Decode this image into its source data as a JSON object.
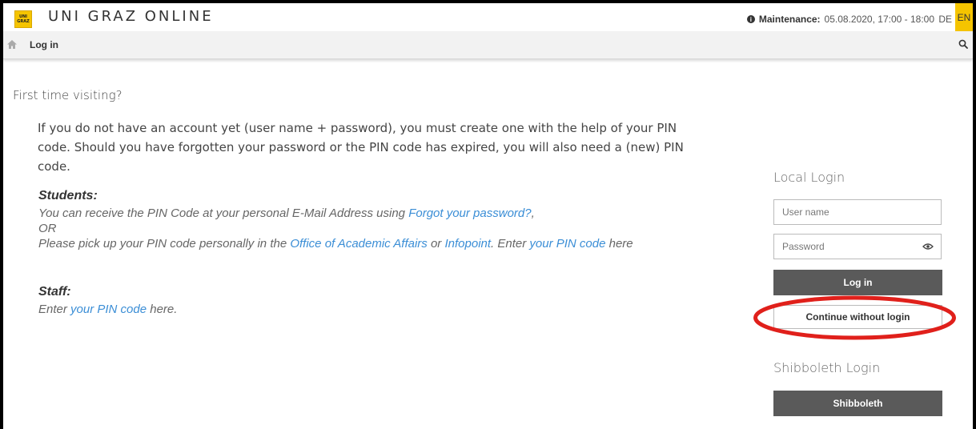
{
  "header": {
    "logo_text_top": "UNI",
    "logo_text_bottom": "GRAZ",
    "brand": "UNI GRAZ ONLINE",
    "maintenance_label": "Maintenance:",
    "maintenance_value": "05.08.2020, 17:00 - 18:00",
    "lang_de": "DE",
    "lang_en": "EN",
    "accent_color": "#f5c400"
  },
  "nav": {
    "title": "Log in",
    "home_icon": "home-icon",
    "search_icon": "search-icon"
  },
  "content": {
    "first_time": "First time visiting?",
    "intro": "If you do not have an account yet (user name + password), you must create one with the help of your PIN code. Should you have forgotten your password or the PIN code has expired, you will also need a (new) PIN code.",
    "students_heading": "Students:",
    "students_line1_pre": "You can receive the PIN Code at your personal E-Mail Address using ",
    "students_link_forgot": "Forgot your password?",
    "students_line1_post": ",",
    "students_or": "OR",
    "students_line3_pre": "Please pick up your PIN code personally in the ",
    "students_link_office": "Office of Academic Affairs",
    "students_or2": " or ",
    "students_link_infopoint": "Infopoint",
    "students_line3_mid": ". Enter ",
    "students_link_pin": "your PIN code",
    "students_line3_post": " here",
    "staff_heading": "Staff:",
    "staff_pre": "Enter ",
    "staff_link_pin": "your PIN code",
    "staff_post": " here."
  },
  "login": {
    "local_heading": "Local Login",
    "username_placeholder": "User name",
    "password_placeholder": "Password",
    "login_button": "Log in",
    "continue_button": "Continue without login",
    "shibboleth_heading": "Shibboleth Login",
    "shibboleth_button": "Shibboleth",
    "highlight_color": "#e0201b"
  }
}
